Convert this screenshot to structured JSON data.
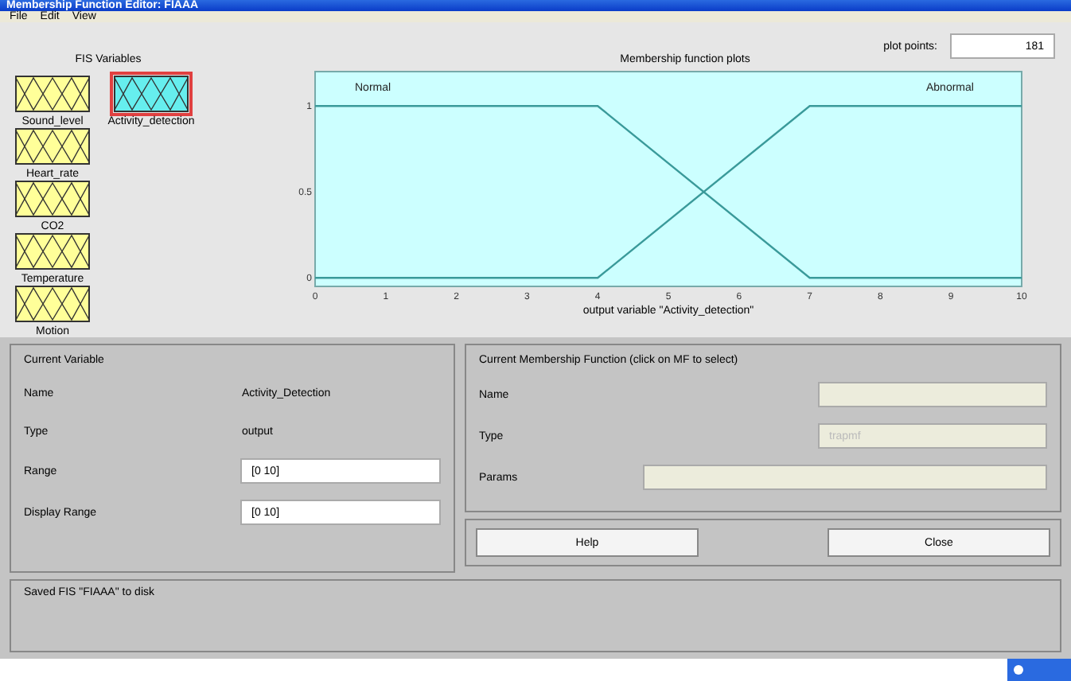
{
  "window": {
    "title": "Membership Function Editor: FIAAA"
  },
  "menu": [
    "File",
    "Edit",
    "View"
  ],
  "fis_variables": {
    "title": "FIS Variables",
    "inputs": [
      {
        "name": "Sound_level",
        "selected": false
      },
      {
        "name": "Heart_rate",
        "selected": false
      },
      {
        "name": "CO2",
        "selected": false
      },
      {
        "name": "Temperature",
        "selected": false
      },
      {
        "name": "Motion",
        "selected": false
      }
    ],
    "outputs": [
      {
        "name": "Activity_detection",
        "selected": true
      }
    ]
  },
  "plot_points": {
    "label": "plot points:",
    "value": "181"
  },
  "plot": {
    "chart_data": {
      "type": "line",
      "title": "Membership function plots",
      "xlabel": "output variable \"Activity_detection\"",
      "x": [
        0,
        4,
        7,
        10
      ],
      "series": [
        {
          "name": "Normal",
          "color": "#3a9a9a",
          "values": [
            1,
            1,
            0,
            0
          ]
        },
        {
          "name": "Abnormal",
          "color": "#3a9a9a",
          "values": [
            0,
            0,
            1,
            1
          ]
        }
      ],
      "xlim": [
        0,
        10
      ],
      "ylim": [
        -0.05,
        1.2
      ],
      "xticks": [
        0,
        1,
        2,
        3,
        4,
        5,
        6,
        7,
        8,
        9,
        10
      ],
      "yticks": [
        0,
        0.5,
        1
      ]
    }
  },
  "current_variable": {
    "title": "Current Variable",
    "name_label": "Name",
    "name": "Activity_Detection",
    "type_label": "Type",
    "type": "output",
    "range_label": "Range",
    "range": "[0 10]",
    "display_range_label": "Display Range",
    "display_range": "[0 10]"
  },
  "current_mf": {
    "title": "Current Membership Function (click on MF to select)",
    "name_label": "Name",
    "type_label": "Type",
    "type": "trapmf",
    "params_label": "Params"
  },
  "buttons": [
    "Help",
    "Close"
  ],
  "status": "Saved FIS \"FIAAA\" to disk"
}
